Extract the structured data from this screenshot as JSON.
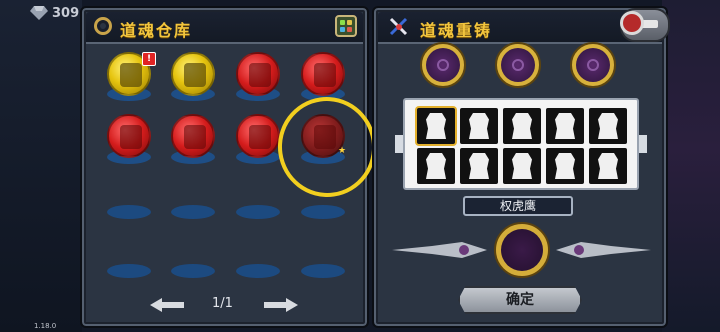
{
  "hud": {
    "currency_value": "309",
    "version": "1.18.0"
  },
  "storage_panel": {
    "title": "道魂仓库",
    "orbs": [
      {
        "type": "gold",
        "badge": "!"
      },
      {
        "type": "gold",
        "badge": ""
      },
      {
        "type": "red",
        "badge": ""
      },
      {
        "type": "red",
        "badge": ""
      },
      {
        "type": "red",
        "badge": ""
      },
      {
        "type": "red",
        "badge": ""
      },
      {
        "type": "red",
        "badge": ""
      },
      {
        "type": "dim",
        "badge": ""
      }
    ],
    "star_glyph": "★",
    "pager": {
      "label": "1/1"
    }
  },
  "recast_panel": {
    "title": "道魂重铸",
    "selected_hero_name": "权虎鹰",
    "confirm_label": "确定"
  },
  "colors": {
    "title_gold": "#f2c53d",
    "highlight_yellow": "#f2cf1f"
  }
}
